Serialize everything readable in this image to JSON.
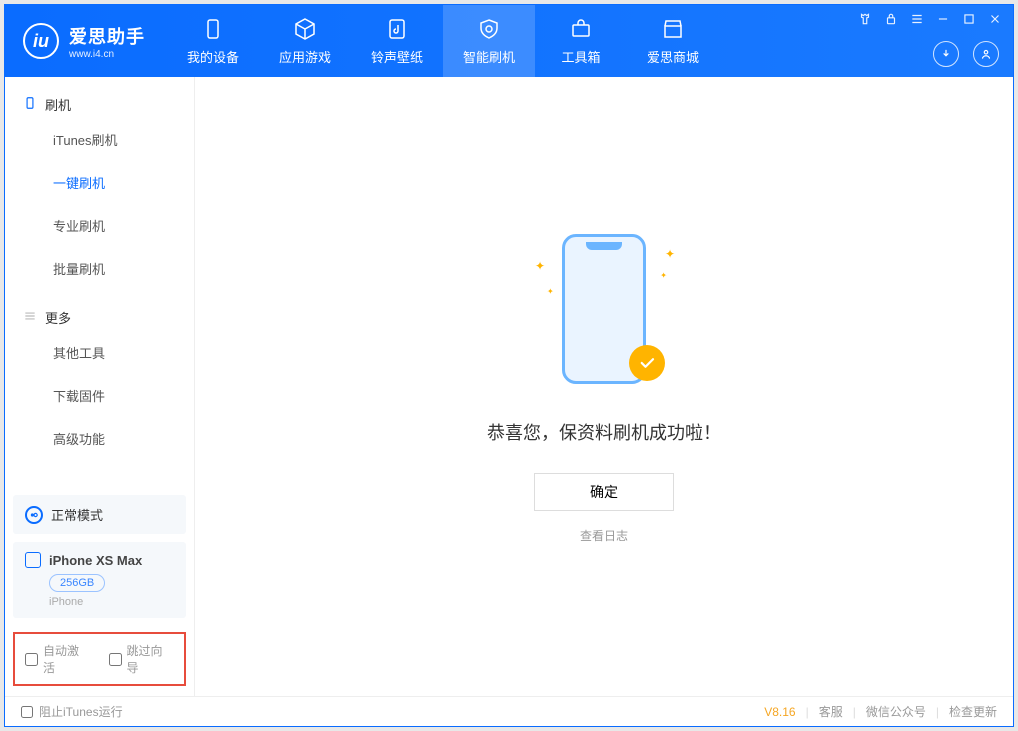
{
  "app": {
    "name_cn": "爱思助手",
    "name_en": "www.i4.cn"
  },
  "nav": {
    "items": [
      {
        "label": "我的设备"
      },
      {
        "label": "应用游戏"
      },
      {
        "label": "铃声壁纸"
      },
      {
        "label": "智能刷机"
      },
      {
        "label": "工具箱"
      },
      {
        "label": "爱思商城"
      }
    ]
  },
  "sidebar": {
    "group1_label": "刷机",
    "items1": [
      {
        "label": "iTunes刷机"
      },
      {
        "label": "一键刷机"
      },
      {
        "label": "专业刷机"
      },
      {
        "label": "批量刷机"
      }
    ],
    "group2_label": "更多",
    "items2": [
      {
        "label": "其他工具"
      },
      {
        "label": "下载固件"
      },
      {
        "label": "高级功能"
      }
    ],
    "status_label": "正常模式",
    "device": {
      "name": "iPhone XS Max",
      "storage": "256GB",
      "type": "iPhone"
    },
    "checkbox1": "自动激活",
    "checkbox2": "跳过向导"
  },
  "main": {
    "message": "恭喜您，保资料刷机成功啦！",
    "ok_button": "确定",
    "view_log": "查看日志"
  },
  "footer": {
    "block_itunes": "阻止iTunes运行",
    "version": "V8.16",
    "links": [
      "客服",
      "微信公众号",
      "检查更新"
    ]
  }
}
